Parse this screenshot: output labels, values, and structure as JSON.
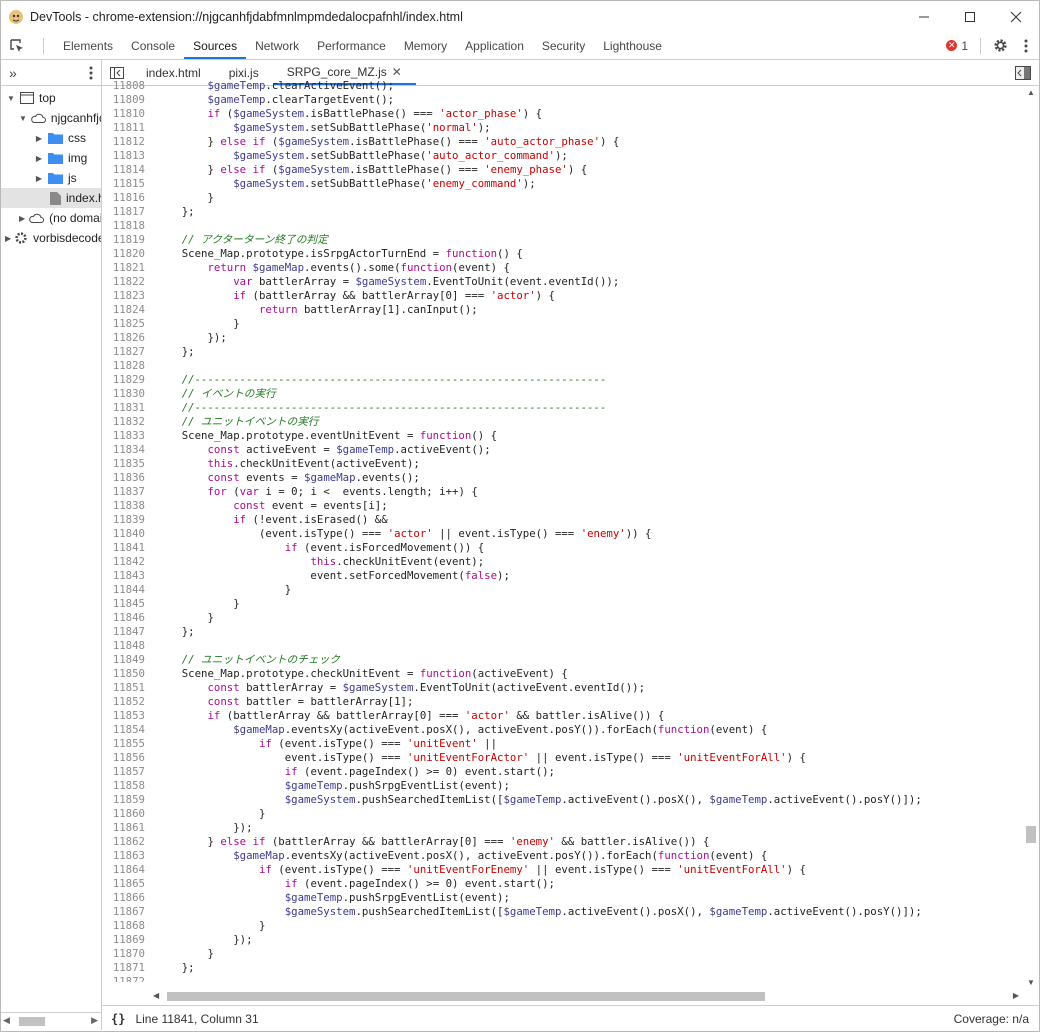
{
  "window": {
    "title": "DevTools - chrome-extension://njgcanhfjdabfmnlmpmdedalocpafnhl/index.html"
  },
  "toolbar": {
    "tabs": [
      "Elements",
      "Console",
      "Sources",
      "Network",
      "Performance",
      "Memory",
      "Application",
      "Security",
      "Lighthouse"
    ],
    "active": "Sources",
    "error_count": "1"
  },
  "sidebar": {
    "items": [
      {
        "label": "top",
        "icon": "frame-icon",
        "indent": 0,
        "arrow": "▼"
      },
      {
        "label": "njgcanhfjdabfmnlmpmdedalocpafnhl",
        "icon": "cloud-icon",
        "indent": 1,
        "arrow": "▼"
      },
      {
        "label": "css",
        "icon": "folder-icon",
        "indent": 2,
        "arrow": "▶"
      },
      {
        "label": "img",
        "icon": "folder-icon",
        "indent": 2,
        "arrow": "▶"
      },
      {
        "label": "js",
        "icon": "folder-icon",
        "indent": 2,
        "arrow": "▶"
      },
      {
        "label": "index.html",
        "icon": "file-icon",
        "indent": 3,
        "arrow": "",
        "selected": true
      },
      {
        "label": "(no domain)",
        "icon": "cloud-icon",
        "indent": 1,
        "arrow": "▶"
      },
      {
        "label": "vorbisdecoder",
        "icon": "gear-icon",
        "indent": 0,
        "arrow": "▶"
      }
    ]
  },
  "editor": {
    "files": [
      "index.html",
      "pixi.js",
      "SRPG_core_MZ.js"
    ],
    "active_file": "SRPG_core_MZ.js"
  },
  "code": {
    "first_line": 11808,
    "lines": [
      "        $gameTemp.clearActiveEvent();",
      "        $gameTemp.clearTargetEvent();",
      "        if ($gameSystem.isBattlePhase() === 'actor_phase') {",
      "            $gameSystem.setSubBattlePhase('normal');",
      "        } else if ($gameSystem.isBattlePhase() === 'auto_actor_phase') {",
      "            $gameSystem.setSubBattlePhase('auto_actor_command');",
      "        } else if ($gameSystem.isBattlePhase() === 'enemy_phase') {",
      "            $gameSystem.setSubBattlePhase('enemy_command');",
      "        }",
      "    };",
      "",
      "    // アクターターン終了の判定",
      "    Scene_Map.prototype.isSrpgActorTurnEnd = function() {",
      "        return $gameMap.events().some(function(event) {",
      "            var battlerArray = $gameSystem.EventToUnit(event.eventId());",
      "            if (battlerArray && battlerArray[0] === 'actor') {",
      "                return battlerArray[1].canInput();",
      "            }",
      "        });",
      "    };",
      "",
      "    //----------------------------------------------------------------",
      "    // イベントの実行",
      "    //----------------------------------------------------------------",
      "    // ユニットイベントの実行",
      "    Scene_Map.prototype.eventUnitEvent = function() {",
      "        const activeEvent = $gameTemp.activeEvent();",
      "        this.checkUnitEvent(activeEvent);",
      "        const events = $gameMap.events();",
      "        for (var i = 0; i <  events.length; i++) {",
      "            const event = events[i];",
      "            if (!event.isErased() &&",
      "                (event.isType() === 'actor' || event.isType() === 'enemy')) {",
      "                    if (event.isForcedMovement()) {",
      "                        this.checkUnitEvent(event);",
      "                        event.setForcedMovement(false);",
      "                    }",
      "            }",
      "        }",
      "    };",
      "",
      "    // ユニットイベントのチェック",
      "    Scene_Map.prototype.checkUnitEvent = function(activeEvent) {",
      "        const battlerArray = $gameSystem.EventToUnit(activeEvent.eventId());",
      "        const battler = battlerArray[1];",
      "        if (battlerArray && battlerArray[0] === 'actor' && battler.isAlive()) {",
      "            $gameMap.eventsXy(activeEvent.posX(), activeEvent.posY()).forEach(function(event) {",
      "                if (event.isType() === 'unitEvent' ||",
      "                    event.isType() === 'unitEventForActor' || event.isType() === 'unitEventForAll') {",
      "                    if (event.pageIndex() >= 0) event.start();",
      "                    $gameTemp.pushSrpgEventList(event);",
      "                    $gameSystem.pushSearchedItemList([$gameTemp.activeEvent().posX(), $gameTemp.activeEvent().posY()]);",
      "                }",
      "            });",
      "        } else if (battlerArray && battlerArray[0] === 'enemy' && battler.isAlive()) {",
      "            $gameMap.eventsXy(activeEvent.posX(), activeEvent.posY()).forEach(function(event) {",
      "                if (event.isType() === 'unitEventForEnemy' || event.isType() === 'unitEventForAll') {",
      "                    if (event.pageIndex() >= 0) event.start();",
      "                    $gameTemp.pushSrpgEventList(event);",
      "                    $gameSystem.pushSearchedItemList([$gameTemp.activeEvent().posX(), $gameTemp.activeEvent().posY()]);",
      "                }",
      "            });",
      "        }",
      "    };",
      "",
      ""
    ]
  },
  "status": {
    "braces": "{}",
    "position": "Line 11841, Column 31",
    "coverage": "Coverage: n/a"
  }
}
